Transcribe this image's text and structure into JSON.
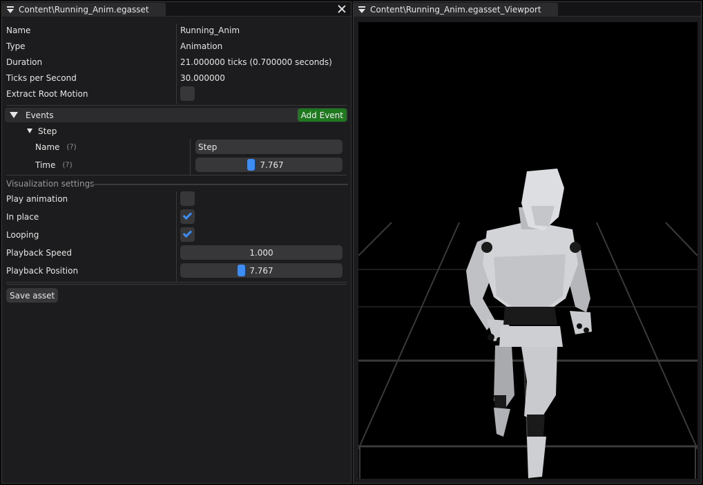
{
  "properties_panel": {
    "tab_title": "Content\\Running_Anim.egasset",
    "rows": [
      {
        "label": "Name",
        "value": "Running_Anim"
      },
      {
        "label": "Type",
        "value": "Animation"
      },
      {
        "label": "Duration",
        "value": "21.000000 ticks (0.700000 seconds)"
      },
      {
        "label": "Ticks per Second",
        "value": "30.000000"
      }
    ],
    "extract_root_motion": {
      "label": "Extract Root Motion",
      "checked": false
    },
    "events": {
      "header": "Events",
      "add_button": "Add Event",
      "items": [
        {
          "name": "Step",
          "name_label": "Name",
          "name_value": "Step",
          "time_label": "Time",
          "time_value": "7.767",
          "help": "(?)"
        }
      ]
    },
    "visualization": {
      "title": "Visualization settings",
      "play_animation": {
        "label": "Play animation",
        "checked": false
      },
      "in_place": {
        "label": "In place",
        "checked": true
      },
      "looping": {
        "label": "Looping",
        "checked": true
      },
      "playback_speed": {
        "label": "Playback Speed",
        "value": "1.000"
      },
      "playback_position": {
        "label": "Playback Position",
        "value": "7.767"
      }
    },
    "save_button": "Save asset"
  },
  "viewport_panel": {
    "tab_title": "Content\\Running_Anim.egasset_Viewport"
  },
  "colors": {
    "accent": "#3d8df5",
    "add_button": "#1f7a1f",
    "panel_bg": "#1c1c1e",
    "mannequin": "#c8cacd"
  }
}
